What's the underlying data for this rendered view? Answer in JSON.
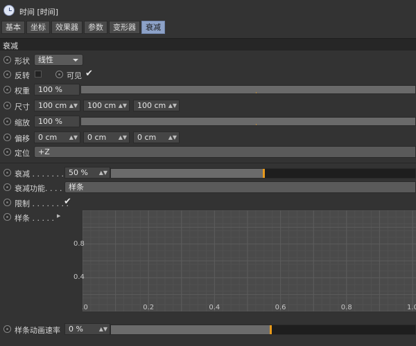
{
  "window": {
    "title": "时间 [时间]"
  },
  "tabs": [
    {
      "label": "基本",
      "active": false
    },
    {
      "label": "坐标",
      "active": false
    },
    {
      "label": "效果器",
      "active": false
    },
    {
      "label": "参数",
      "active": false
    },
    {
      "label": "变形器",
      "active": false
    },
    {
      "label": "衰减",
      "active": true
    }
  ],
  "section": {
    "title": "衰减"
  },
  "fields": {
    "shape": {
      "label": "形状",
      "value": "线性"
    },
    "invert": {
      "label": "反转",
      "checked": false
    },
    "visible": {
      "label": "可见",
      "checked": true
    },
    "weight": {
      "label": "权重",
      "value": "100 %"
    },
    "size": {
      "label": "尺寸",
      "x": "100 cm",
      "y": "100 cm",
      "z": "100 cm"
    },
    "scale": {
      "label": "缩放",
      "value": "100 %"
    },
    "offset": {
      "label": "偏移",
      "x": "0 cm",
      "y": "0 cm",
      "z": "0 cm"
    },
    "orientation": {
      "label": "定位",
      "value": "+Z"
    },
    "falloff": {
      "label": "衰减 . . . . . . .",
      "value": "50 %",
      "fraction": 0.5
    },
    "falloff_function": {
      "label": "衰减功能. . . .",
      "value": "样条"
    },
    "clamp": {
      "label": "限制 . . . . . . . .",
      "checked": true
    },
    "spline": {
      "label": "样条 . . . . ."
    },
    "spline_anim_speed": {
      "label": "样条动画速率",
      "value": "0 %",
      "fraction": 0
    }
  },
  "chart_data": {
    "type": "line",
    "title": "",
    "xlabel": "",
    "ylabel": "",
    "x_ticks": [
      "0.0",
      "0.2",
      "0.4",
      "0.6",
      "0.8",
      "1.0"
    ],
    "y_ticks": [
      "0.4",
      "0.8"
    ],
    "xlim": [
      0,
      1
    ],
    "ylim": [
      0,
      1.2
    ],
    "grid": true,
    "series": []
  },
  "colors": {
    "accent": "#e89a1c",
    "active_tab": "#8da2c8"
  }
}
